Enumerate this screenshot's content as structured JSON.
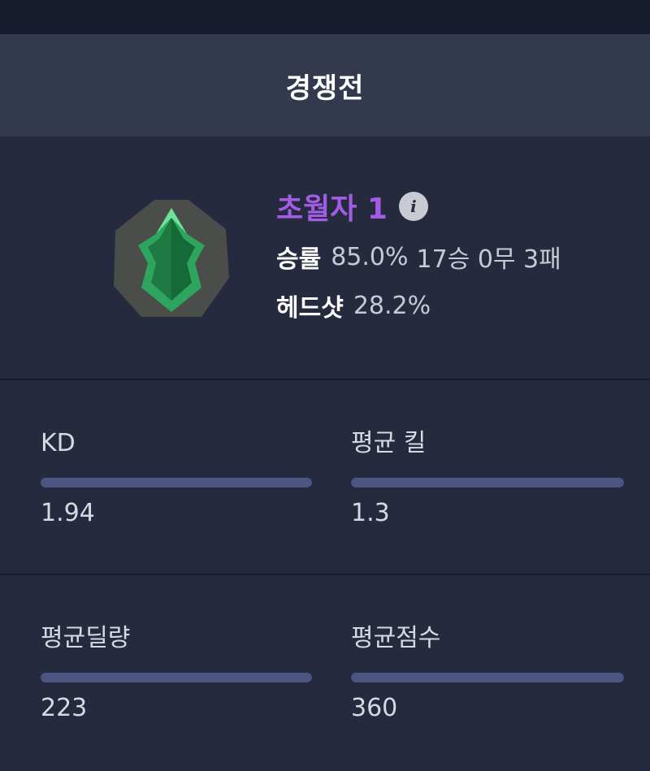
{
  "card": {
    "title": "경쟁전"
  },
  "rank": {
    "name": "초월자 1",
    "emblem_icon": "emerald-rank-emblem-icon",
    "info_icon": "info-icon",
    "win_rate_label": "승률",
    "win_rate_value": "85.0%",
    "record": "17승 0무 3패",
    "headshot_label": "헤드샷",
    "headshot_value": "28.2%",
    "name_color": "#a35ce6"
  },
  "metrics": [
    {
      "label": "KD",
      "value": "1.94",
      "fill": 1.0
    },
    {
      "label": "평균 킬",
      "value": "1.3",
      "fill": 1.0
    },
    {
      "label": "평균딜량",
      "value": "223",
      "fill": 1.0
    },
    {
      "label": "평균점수",
      "value": "360",
      "fill": 1.0
    }
  ],
  "colors": {
    "background": "#262a3e",
    "header": "#343a4e",
    "bar": "#4d5683"
  }
}
